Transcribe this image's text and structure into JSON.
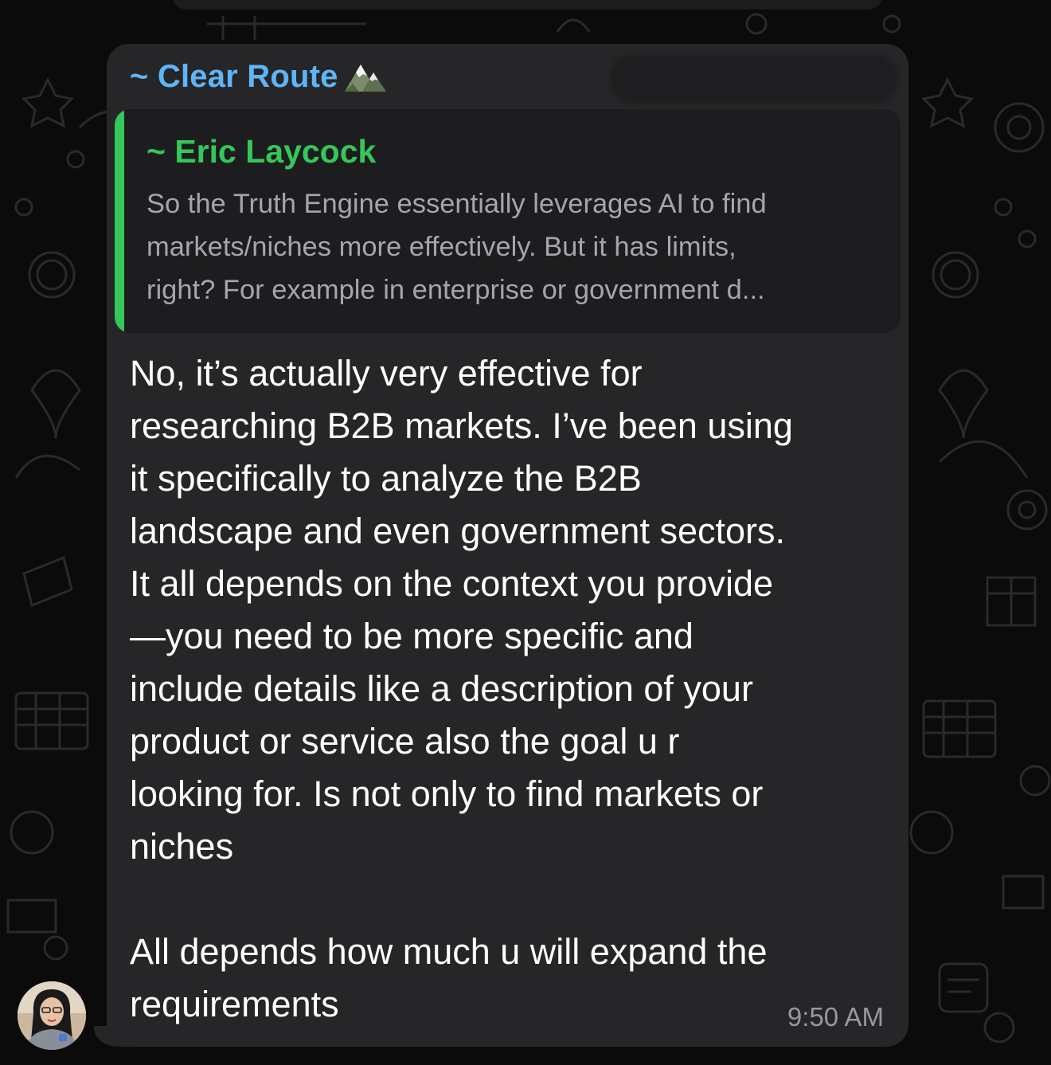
{
  "chat": {
    "message": {
      "sender_name": "~ Clear Route",
      "sender_icon": "mountain-emoji-icon",
      "quoted": {
        "author": "~ Eric Laycock",
        "lines": [
          "So the Truth Engine essentially leverages AI to find",
          "markets/niches more effectively. But it has limits,",
          "right? For example in enterprise or government d..."
        ]
      },
      "body_lines": [
        "No, it’s actually very effective for",
        "researching B2B markets. I’ve been using",
        "it specifically to analyze the B2B",
        "landscape and even government sectors.",
        "It all depends on the context you provide",
        "—you need to be more specific and",
        "include details like a description of your",
        "product or service also the goal u r",
        "looking for. Is not only to find markets or",
        "niches",
        "",
        "All depends how much u will expand the",
        "requirements"
      ],
      "timestamp": "9:50 AM"
    },
    "colors": {
      "background": "#0b0b0b",
      "bubble": "#262628",
      "sender": "#5eb5f7",
      "quote_accent": "#34c759",
      "text": "#ffffff",
      "muted": "#98989d"
    }
  }
}
